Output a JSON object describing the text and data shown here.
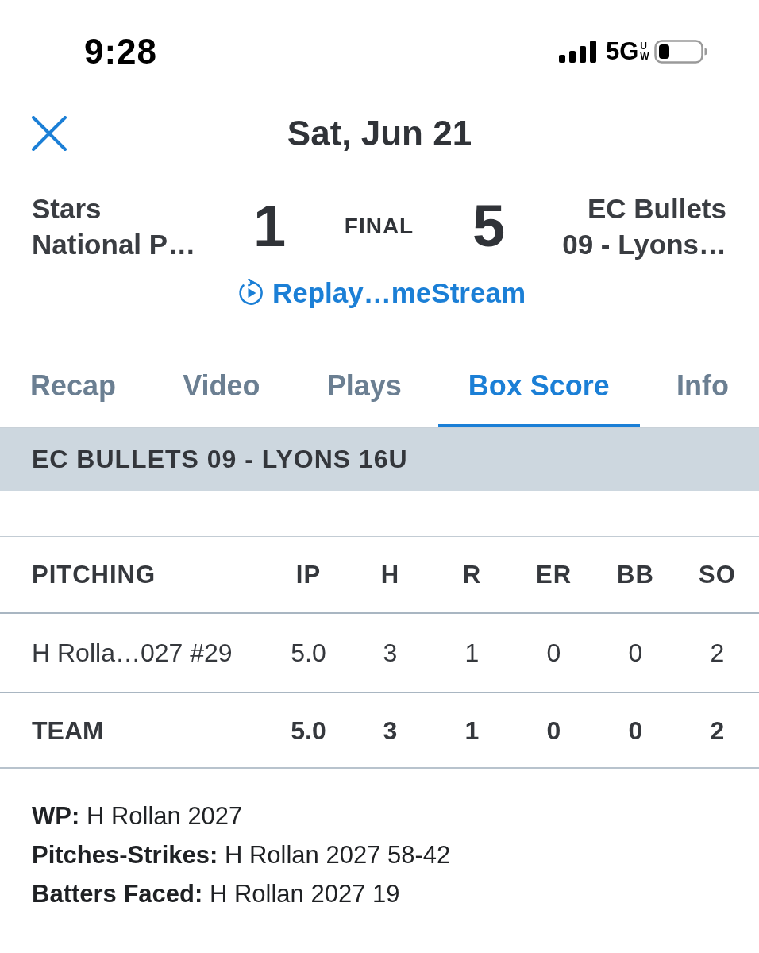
{
  "status_bar": {
    "time": "9:28",
    "network": "5G",
    "network_sub": "UW"
  },
  "header": {
    "title": "Sat, Jun 21"
  },
  "scoreboard": {
    "away": {
      "name": "Stars\nNational P…",
      "score": "1"
    },
    "status": "FINAL",
    "home": {
      "name": "EC Bullets\n09 - Lyons…",
      "score": "5"
    },
    "replay_link": "Replay…meStream"
  },
  "tabs": [
    {
      "label": "Recap",
      "selected": false
    },
    {
      "label": "Video",
      "selected": false
    },
    {
      "label": "Plays",
      "selected": false
    },
    {
      "label": "Box Score",
      "selected": true
    },
    {
      "label": "Info",
      "selected": false
    }
  ],
  "section": {
    "title": "EC BULLETS 09 - LYONS 16U"
  },
  "table": {
    "columns": [
      "PITCHING",
      "IP",
      "H",
      "R",
      "ER",
      "BB",
      "SO"
    ],
    "rows": [
      {
        "kind": "player",
        "cells": [
          "H Rolla…027 #29",
          "5.0",
          "3",
          "1",
          "0",
          "0",
          "2"
        ]
      },
      {
        "kind": "total",
        "cells": [
          "TEAM",
          "5.0",
          "3",
          "1",
          "0",
          "0",
          "2"
        ]
      }
    ]
  },
  "notes": [
    "**WP:** H Rollan 2027",
    "**Pitches-Strikes:** H Rollan 2027 58-42",
    "**Batters Faced:** H Rollan 2027 19"
  ]
}
